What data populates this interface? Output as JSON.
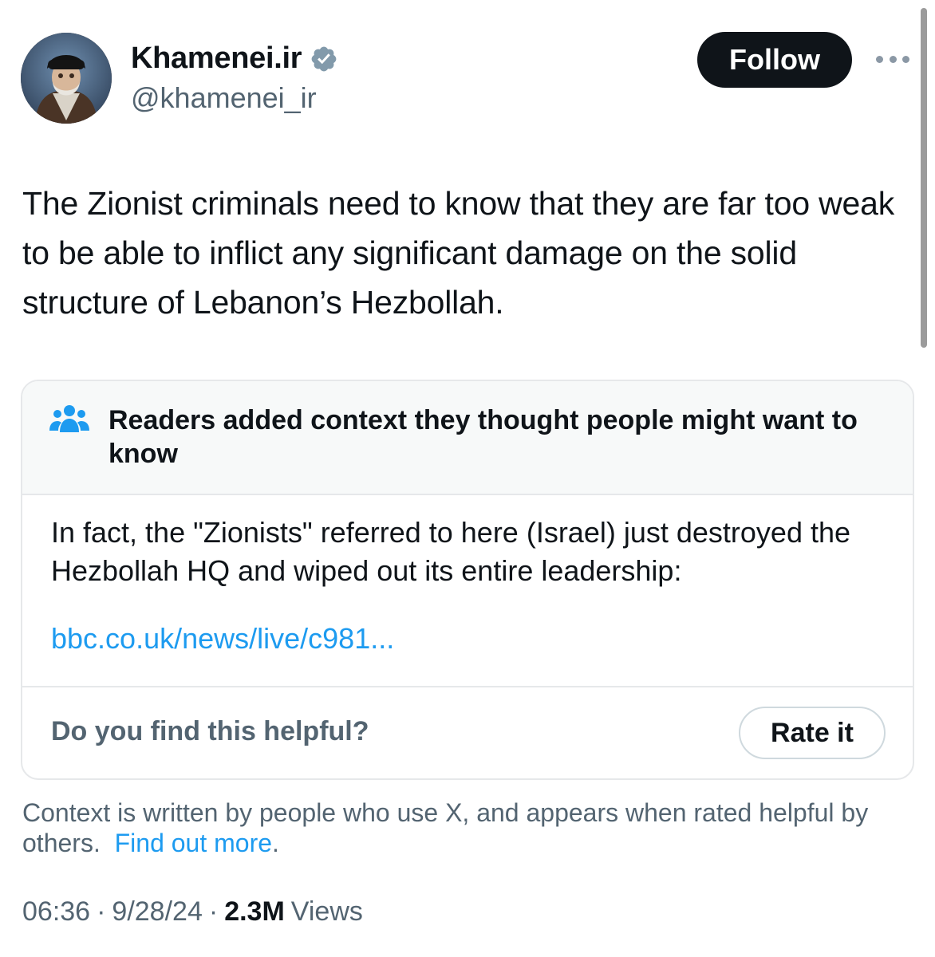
{
  "header": {
    "display_name": "Khamenei.ir",
    "handle": "@khamenei_ir",
    "follow_label": "Follow",
    "verified": true
  },
  "tweet": {
    "text": "The Zionist criminals need to know that they are far too weak to be able to inflict any significant damage on the solid structure of Lebanon’s Hezbollah."
  },
  "community_note": {
    "title": "Readers added context they thought people might want to know",
    "body": "In fact, the \"Zionists\" referred to here (Israel) just destroyed the Hezbollah HQ and wiped out its entire leadership:",
    "link": "bbc.co.uk/news/live/c981...",
    "helpful_question": "Do you find this helpful?",
    "rate_label": "Rate it"
  },
  "footer": {
    "context_text": "Context is written by people who use X, and appears when rated helpful by others.",
    "find_out_more": "Find out more",
    "time": "06:36",
    "date": "9/28/24",
    "views_count": "2.3M",
    "views_label": "Views",
    "separator": "·"
  },
  "colors": {
    "text_primary": "#0f1419",
    "text_secondary": "#536471",
    "link": "#1d9bf0",
    "verified_badge": "#829aab",
    "note_header_bg": "#f7f9f9"
  },
  "icons": {
    "verified": "verified-badge-icon",
    "more": "more-options-icon",
    "people": "people-icon"
  }
}
